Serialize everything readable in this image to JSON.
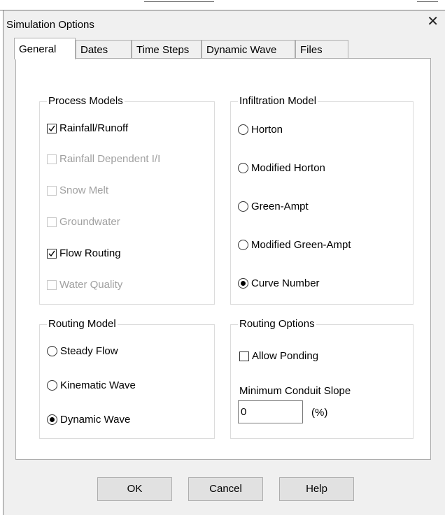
{
  "dialog": {
    "title": "Simulation Options",
    "close_glyph": "✕"
  },
  "tabs": [
    {
      "label": "General",
      "active": true
    },
    {
      "label": "Dates",
      "active": false
    },
    {
      "label": "Time Steps",
      "active": false
    },
    {
      "label": "Dynamic Wave",
      "active": false
    },
    {
      "label": "Files",
      "active": false
    }
  ],
  "process_models": {
    "legend": "Process Models",
    "items": [
      {
        "label": "Rainfall/Runoff",
        "checked": true,
        "enabled": true
      },
      {
        "label": "Rainfall Dependent I/I",
        "checked": false,
        "enabled": false
      },
      {
        "label": "Snow Melt",
        "checked": false,
        "enabled": false
      },
      {
        "label": "Groundwater",
        "checked": false,
        "enabled": false
      },
      {
        "label": "Flow Routing",
        "checked": true,
        "enabled": true
      },
      {
        "label": "Water Quality",
        "checked": false,
        "enabled": false
      }
    ]
  },
  "infiltration_model": {
    "legend": "Infiltration Model",
    "options": [
      {
        "label": "Horton",
        "selected": false
      },
      {
        "label": "Modified Horton",
        "selected": false
      },
      {
        "label": "Green-Ampt",
        "selected": false
      },
      {
        "label": "Modified Green-Ampt",
        "selected": false
      },
      {
        "label": "Curve Number",
        "selected": true
      }
    ]
  },
  "routing_model": {
    "legend": "Routing Model",
    "options": [
      {
        "label": "Steady Flow",
        "selected": false
      },
      {
        "label": "Kinematic Wave",
        "selected": false
      },
      {
        "label": "Dynamic Wave",
        "selected": true
      }
    ]
  },
  "routing_options": {
    "legend": "Routing Options",
    "allow_ponding": {
      "label": "Allow Ponding",
      "checked": false
    },
    "min_slope_label": "Minimum Conduit Slope",
    "min_slope_value": "0",
    "min_slope_unit": "(%)"
  },
  "buttons": {
    "ok": "OK",
    "cancel": "Cancel",
    "help": "Help"
  }
}
